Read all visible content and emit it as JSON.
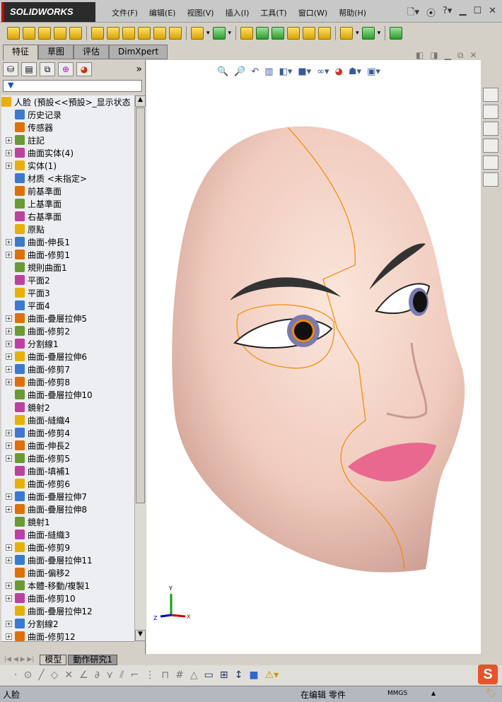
{
  "app": {
    "logo": "SOLIDWORKS"
  },
  "menu": [
    "文件(F)",
    "编辑(E)",
    "视图(V)",
    "插入(I)",
    "工具(T)",
    "窗口(W)",
    "帮助(H)"
  ],
  "tabs": [
    "特征",
    "草图",
    "评估",
    "DimXpert"
  ],
  "filter_icon": "funnel-icon",
  "tree": [
    {
      "label": "人脸  (預設<<預設>_显示状态",
      "exp": false
    },
    {
      "label": "历史记录",
      "exp": false
    },
    {
      "label": "传感器",
      "exp": false
    },
    {
      "label": "註記",
      "exp": true
    },
    {
      "label": "曲面实体(4)",
      "exp": true
    },
    {
      "label": "实体(1)",
      "exp": true
    },
    {
      "label": "材质 <未指定>",
      "exp": false
    },
    {
      "label": "前基準面",
      "exp": false
    },
    {
      "label": "上基準面",
      "exp": false
    },
    {
      "label": "右基準面",
      "exp": false
    },
    {
      "label": "原點",
      "exp": false
    },
    {
      "label": "曲面-伸長1",
      "exp": true
    },
    {
      "label": "曲面-修剪1",
      "exp": true
    },
    {
      "label": "規則曲面1",
      "exp": false
    },
    {
      "label": "平面2",
      "exp": false
    },
    {
      "label": "平面3",
      "exp": false
    },
    {
      "label": "平面4",
      "exp": false
    },
    {
      "label": "曲面-疊層拉伸5",
      "exp": true
    },
    {
      "label": "曲面-修剪2",
      "exp": true
    },
    {
      "label": "分割線1",
      "exp": true
    },
    {
      "label": "曲面-疊層拉伸6",
      "exp": true
    },
    {
      "label": "曲面-修剪7",
      "exp": true
    },
    {
      "label": "曲面-修剪8",
      "exp": true
    },
    {
      "label": "曲面-疊層拉伸10",
      "exp": false
    },
    {
      "label": "鏡射2",
      "exp": false
    },
    {
      "label": "曲面-縫織4",
      "exp": false
    },
    {
      "label": "曲面-修剪4",
      "exp": true
    },
    {
      "label": "曲面-伸長2",
      "exp": true
    },
    {
      "label": "曲面-修剪5",
      "exp": true
    },
    {
      "label": "曲面-填補1",
      "exp": false
    },
    {
      "label": "曲面-修剪6",
      "exp": false
    },
    {
      "label": "曲面-疊層拉伸7",
      "exp": true
    },
    {
      "label": "曲面-疊層拉伸8",
      "exp": true
    },
    {
      "label": "鏡射1",
      "exp": false
    },
    {
      "label": "曲面-縫織3",
      "exp": false
    },
    {
      "label": "曲面-修剪9",
      "exp": true
    },
    {
      "label": "曲面-疊層拉伸11",
      "exp": true
    },
    {
      "label": "曲面-偏移2",
      "exp": false
    },
    {
      "label": "本體-移動/複製1",
      "exp": true
    },
    {
      "label": "曲面-修剪10",
      "exp": true
    },
    {
      "label": "曲面-疊層拉伸12",
      "exp": false
    },
    {
      "label": "分割線2",
      "exp": true
    },
    {
      "label": "曲面-修剪12",
      "exp": true
    }
  ],
  "bottom_tabs": [
    "模型",
    "動作研究1"
  ],
  "triad": {
    "x": "X",
    "y": "Y",
    "z": "Z"
  },
  "status": {
    "left": "人脸",
    "mode": "在编辑 零件",
    "units": "MMGS"
  },
  "colors": {
    "skin": "#f1cfc2",
    "lips": "#e8688f",
    "outline": "#f08a00"
  }
}
